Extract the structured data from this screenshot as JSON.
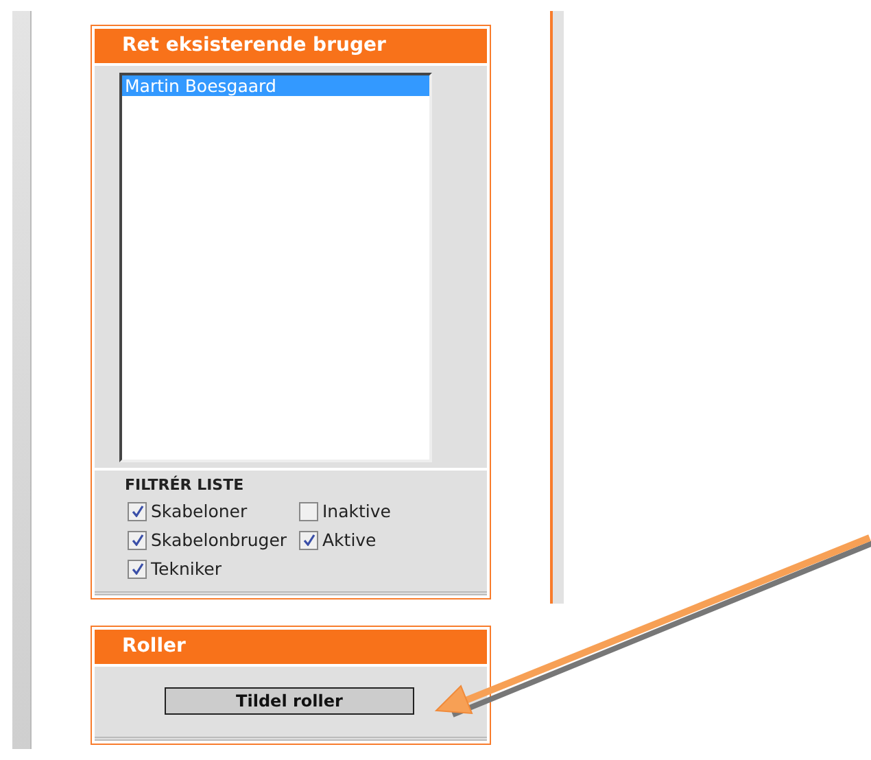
{
  "user_panel": {
    "title": "Ret eksisterende bruger",
    "users": [
      {
        "name": "Martin Boesgaard",
        "selected": true
      }
    ],
    "filter": {
      "heading": "FILTRÉR LISTE",
      "options": [
        {
          "label": "Skabeloner",
          "checked": true
        },
        {
          "label": "Inaktive",
          "checked": false
        },
        {
          "label": "Skabelonbruger",
          "checked": true
        },
        {
          "label": "Aktive",
          "checked": true
        },
        {
          "label": "Tekniker",
          "checked": true
        }
      ]
    }
  },
  "roles_panel": {
    "title": "Roller",
    "button": "Tildel roller"
  }
}
